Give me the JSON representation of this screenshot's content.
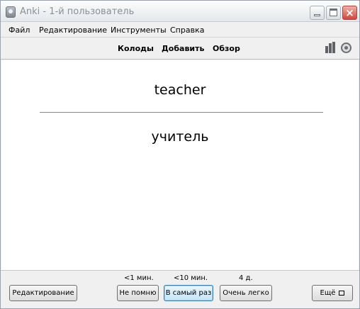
{
  "window": {
    "title": "Anki - 1-й пользователь",
    "icon": "anki-icon",
    "controls": [
      "minimize-icon",
      "maximize-icon",
      "close-icon"
    ]
  },
  "menu": {
    "items": [
      "Файл",
      "Редактирование",
      "Инструменты",
      "Справка"
    ]
  },
  "toolbar": {
    "links": [
      "Колоды",
      "Добавить",
      "Обзор"
    ],
    "icons": [
      "stats-icon",
      "sync-icon"
    ]
  },
  "card": {
    "front": "teacher",
    "back": "учитель"
  },
  "bottom": {
    "edit_label": "Редактирование",
    "answers": [
      {
        "interval": "<1 мин.",
        "label": "Не помню"
      },
      {
        "interval": "<10 мин.",
        "label": "В самый раз"
      },
      {
        "interval": "4 д.",
        "label": "Очень легко"
      }
    ],
    "more_label": "Ещё"
  },
  "colors": {
    "focus_border": "#3c7fb1",
    "close_button": "#d4453a"
  }
}
